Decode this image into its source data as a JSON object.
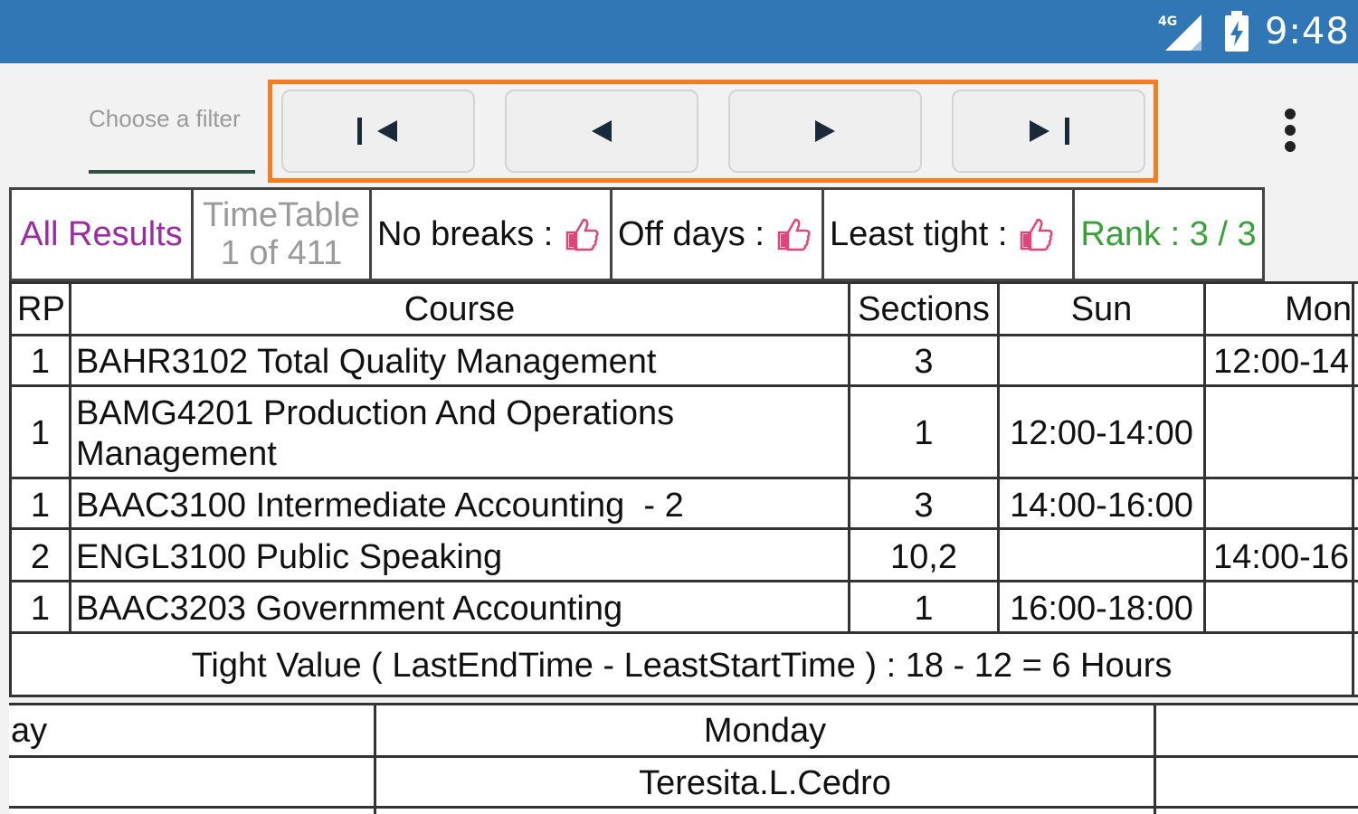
{
  "status_bar": {
    "network_label": "4G",
    "time": "9:48",
    "icons": [
      "signal-icon",
      "battery-charging-icon"
    ]
  },
  "toolbar": {
    "filter_placeholder": "Choose a filter",
    "nav_buttons": [
      {
        "name": "first-page",
        "icon": "skip-to-first-icon"
      },
      {
        "name": "previous-page",
        "icon": "previous-arrow-icon"
      },
      {
        "name": "next-page",
        "icon": "next-arrow-icon"
      },
      {
        "name": "last-page",
        "icon": "skip-to-last-icon"
      }
    ],
    "menu_icon": "overflow-menu-icon"
  },
  "colors": {
    "status_bar": "#3277b5",
    "nav_highlight": "#f57c20",
    "all_results": "#9b2aa4",
    "rank": "#3aa03a",
    "thumbs": "#e0457a"
  },
  "summary": {
    "all_results": "All Results",
    "timetable_label": "TimeTable",
    "timetable_count": "1 of 411",
    "no_breaks": "No breaks :",
    "off_days": "Off days :",
    "least_tight": "Least tight :",
    "rank": "Rank : 3 / 3"
  },
  "table": {
    "headers": [
      "RP",
      "Course",
      "Sections",
      "Sun",
      "Mon"
    ],
    "rows": [
      {
        "rp": "1",
        "course_line1": "BAHR3102 Total Quality Management",
        "course_line2": "",
        "sections": "3",
        "sun": "",
        "mon": "12:00-14"
      },
      {
        "rp": "1",
        "course_line1": "BAMG4201 Production And Operations",
        "course_line2": "Management",
        "sections": "1",
        "sun": "12:00-14:00",
        "mon": ""
      },
      {
        "rp": "1",
        "course_line1": "BAAC3100 Intermediate Accounting  - 2",
        "course_line2": "",
        "sections": "3",
        "sun": "14:00-16:00",
        "mon": ""
      },
      {
        "rp": "2",
        "course_line1": "ENGL3100 Public Speaking",
        "course_line2": "",
        "sections": "10,2",
        "sun": "",
        "mon": "14:00-16"
      },
      {
        "rp": "1",
        "course_line1": "BAAC3203 Government Accounting",
        "course_line2": "",
        "sections": "1",
        "sun": "16:00-18:00",
        "mon": ""
      }
    ],
    "footer": "Tight Value ( LastEndTime - LeastStartTime ) : 18 - 12 = 6 Hours"
  },
  "schedule": {
    "header_left": "ay",
    "header_mid": "Monday",
    "row_mid": "Teresita.L.Cedro"
  }
}
